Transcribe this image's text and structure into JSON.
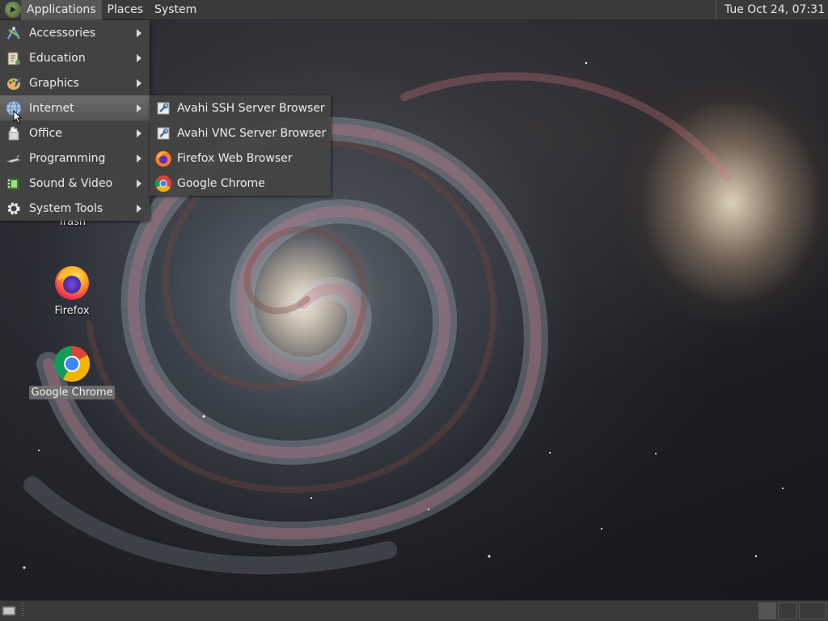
{
  "top_panel": {
    "menus": [
      "Applications",
      "Places",
      "System"
    ],
    "clock": "Tue Oct 24, 07:31",
    "logo_icon": "mate-logo-icon"
  },
  "applications_menu": {
    "items": [
      {
        "label": "Accessories",
        "icon": "accessories-icon",
        "has_submenu": true
      },
      {
        "label": "Education",
        "icon": "education-icon",
        "has_submenu": true
      },
      {
        "label": "Graphics",
        "icon": "graphics-icon",
        "has_submenu": true
      },
      {
        "label": "Internet",
        "icon": "internet-globe-icon",
        "has_submenu": true,
        "highlighted": true
      },
      {
        "label": "Office",
        "icon": "office-icon",
        "has_submenu": true
      },
      {
        "label": "Programming",
        "icon": "programming-icon",
        "has_submenu": true
      },
      {
        "label": "Sound & Video",
        "icon": "sound-video-icon",
        "has_submenu": true
      },
      {
        "label": "System Tools",
        "icon": "system-tools-gear-icon",
        "has_submenu": true
      }
    ]
  },
  "internet_submenu": {
    "items": [
      {
        "label": "Avahi SSH Server Browser",
        "icon": "avahi-icon"
      },
      {
        "label": "Avahi VNC Server Browser",
        "icon": "avahi-icon"
      },
      {
        "label": "Firefox Web Browser",
        "icon": "firefox-icon"
      },
      {
        "label": "Google Chrome",
        "icon": "chrome-icon"
      }
    ]
  },
  "desktop_icons": [
    {
      "label": "Trash",
      "icon": "trash-icon"
    },
    {
      "label": "Firefox",
      "icon": "firefox-icon"
    },
    {
      "label": "Google Chrome",
      "icon": "chrome-icon",
      "selected": true
    }
  ],
  "colors": {
    "panel": "#3a3a3a",
    "menu_bg": "#444444",
    "highlight": "#606060",
    "text": "#ececec"
  }
}
